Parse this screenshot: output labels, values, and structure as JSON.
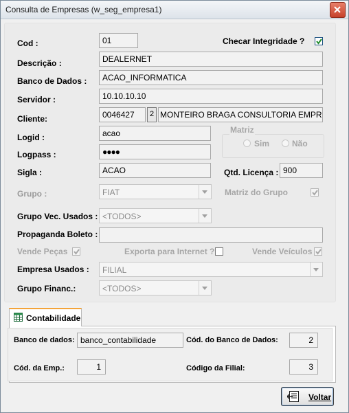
{
  "window": {
    "title": "Consulta de Empresas (w_seg_empresa1)"
  },
  "form": {
    "cod_label": "Cod :",
    "cod_value": "01",
    "checar_label": "Checar Integridade  ?",
    "checar_checked": true,
    "descricao_label": "Descrição :",
    "descricao_value": "DEALERNET",
    "banco_label": "Banco de Dados :",
    "banco_value": "ACAO_INFORMATICA",
    "servidor_label": "Servidor :",
    "servidor_value": "10.10.10.10",
    "cliente_label": "Cliente:",
    "cliente_code": "0046427",
    "cliente_button": "2",
    "cliente_name": "MONTEIRO BRAGA CONSULTORIA EMPRE",
    "logid_label": "Logid :",
    "logid_value": "acao",
    "logpass_label": "Logpass :",
    "logpass_value": "●●●●",
    "matriz_label": "Matriz",
    "matriz_sim": "Sim",
    "matriz_nao": "Não",
    "sigla_label": "Sigla :",
    "sigla_value": "ACAO",
    "qtd_label": "Qtd. Licença :",
    "qtd_value": "900",
    "grupo_label": "Grupo :",
    "grupo_value": "FIAT",
    "matriz_grupo_label": "Matriz do Grupo",
    "matriz_grupo_checked": true,
    "grupo_vec_label": "Grupo Vec. Usados :",
    "grupo_vec_value": "<TODOS>",
    "propaganda_label": "Propaganda Boleto :",
    "propaganda_value": "",
    "vende_pecas_label": "Vende Peças",
    "vende_pecas_checked": true,
    "exporta_label": "Exporta para Internet ?",
    "exporta_checked": false,
    "vende_veiculos_label": "Vende Veículos",
    "vende_veiculos_checked": true,
    "empresa_usados_label": "Empresa Usados :",
    "empresa_usados_value": "FILIAL",
    "grupo_financ_label": "Grupo Financ.:",
    "grupo_financ_value": "<TODOS>"
  },
  "tab": {
    "label": "Contabilidade"
  },
  "contab": {
    "banco_label": "Banco de dados:",
    "banco_value": "banco_contabilidade",
    "cod_banco_label": "Cód. do Banco de Dados:",
    "cod_banco_value": "2",
    "cod_emp_label": "Cód. da Emp.:",
    "cod_emp_value": "1",
    "cod_filial_label": "Código da Filial:",
    "cod_filial_value": "3"
  },
  "buttons": {
    "voltar": "Voltar"
  },
  "icons": [
    "close-icon",
    "checkmark-icon",
    "spreadsheet-icon",
    "exit-icon"
  ],
  "colors": {
    "check": "#1f8b2c",
    "tab_accent": "#f4a43a",
    "close": "#c6402a"
  }
}
